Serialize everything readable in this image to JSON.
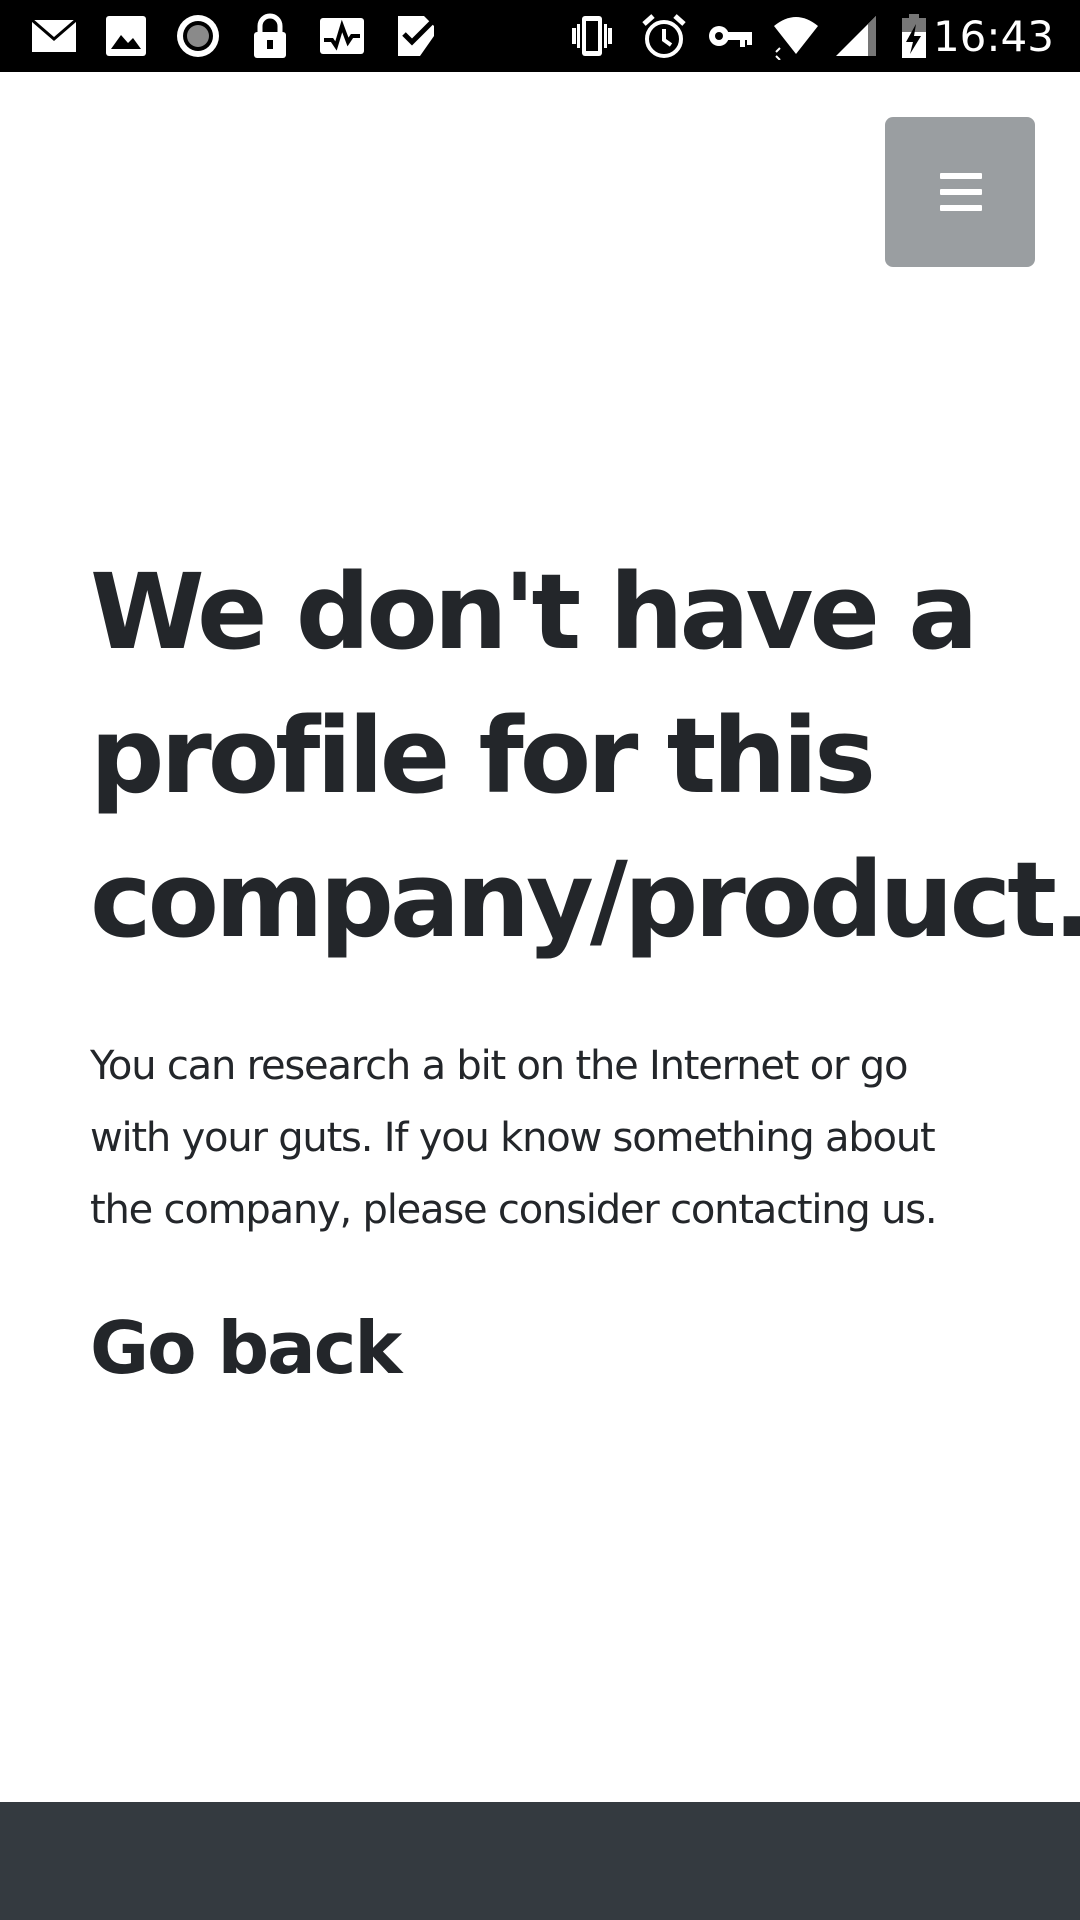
{
  "status_bar": {
    "time": "16:43",
    "left_icons": [
      "mail-icon",
      "image-icon",
      "record-icon",
      "lock-icon",
      "pulse-icon",
      "checklist-icon"
    ],
    "right_icons": [
      "vibrate-icon",
      "alarm-icon",
      "vpn-key-icon",
      "wifi-icon",
      "signal-icon",
      "battery-charging-icon"
    ]
  },
  "header": {
    "menu_icon": "hamburger-menu-icon",
    "menu_color": "#9a9ea1"
  },
  "main": {
    "title_lines": [
      "We don't have a",
      "profile for this",
      "company/product."
    ],
    "text_lines": [
      "You can research a bit on the Internet or go",
      "with your guts. If you know something about",
      "the company, please consider contacting us."
    ],
    "go_back": "Go back"
  },
  "colors": {
    "text": "#23262a",
    "footer": "#343a40",
    "status_bar": "#000000"
  }
}
